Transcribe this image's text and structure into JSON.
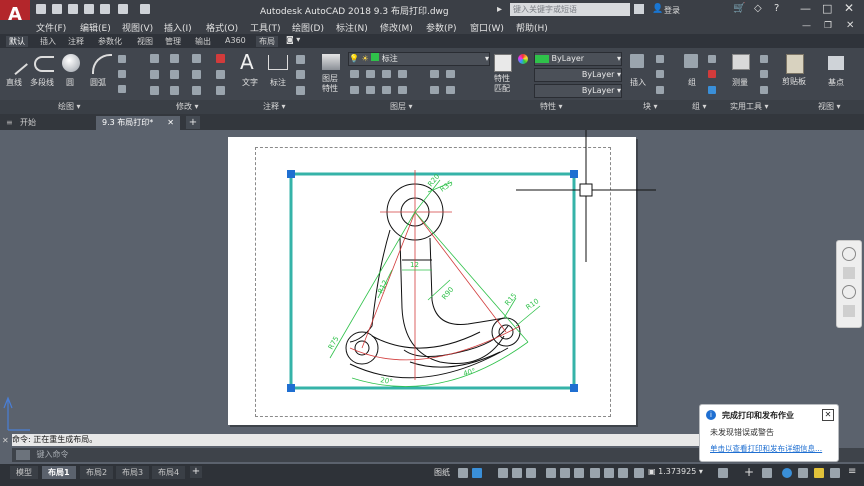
{
  "app": {
    "logo": "A",
    "title": "Autodesk AutoCAD 2018    9.3 布局打印.dwg",
    "search_placeholder": "键入关键字或短语",
    "login": "登录"
  },
  "menu": [
    "文件(F)",
    "编辑(E)",
    "视图(V)",
    "插入(I)",
    "格式(O)",
    "工具(T)",
    "绘图(D)",
    "标注(N)",
    "修改(M)",
    "参数(P)",
    "窗口(W)",
    "帮助(H)"
  ],
  "ribbon_tabs": [
    "默认",
    "插入",
    "注释",
    "参数化",
    "视图",
    "管理",
    "输出",
    "A360",
    "布局"
  ],
  "ribbon": {
    "draw": {
      "line": "直线",
      "polyline": "多段线",
      "circle": "圆",
      "arc": "圆弧"
    },
    "annot": {
      "text": "文字",
      "dim": "标注"
    },
    "layer": {
      "props": "图层\n特性",
      "current": "标注"
    },
    "props": {
      "match": "特性\n匹配",
      "color": "ByLayer",
      "ltype": "ByLayer",
      "lweight": "ByLayer"
    },
    "block": {
      "insert": "插入"
    },
    "group": {
      "group": "组"
    },
    "util": {
      "measure": "测量"
    },
    "clip": {
      "paste": "剪贴板"
    },
    "view": {
      "base": "基点"
    }
  },
  "panels": [
    "绘图 ▾",
    "修改 ▾",
    "注释 ▾",
    "图层 ▾",
    "特性 ▾",
    "块 ▾",
    "组 ▾",
    "实用工具 ▾",
    "视图 ▾"
  ],
  "doc_tabs": [
    "开始",
    "9.3 布局打印*"
  ],
  "command": {
    "history": "命令: 正在重生成布局。",
    "placeholder": "键入命令"
  },
  "layout_tabs": [
    "模型",
    "布局1",
    "布局2",
    "布局3",
    "布局4"
  ],
  "status": {
    "paper": "图纸",
    "scale": "1.373925"
  },
  "notification": {
    "title": "完成打印和发布作业",
    "line1": "未发现错误或警告",
    "link": "单击以查看打印和发布详细信息..."
  },
  "drawing_dims": [
    "R20",
    "R35",
    "R75",
    "R90",
    "R15",
    "R10",
    "60",
    "80",
    "20°",
    "40°",
    "12",
    "12",
    "R12",
    "6",
    "R18"
  ],
  "colors": {
    "accent": "#b3262b",
    "viewport": "#35b3a8",
    "grip": "#1f6fd1",
    "green": "#2fc14a",
    "red": "#d23b3b"
  }
}
